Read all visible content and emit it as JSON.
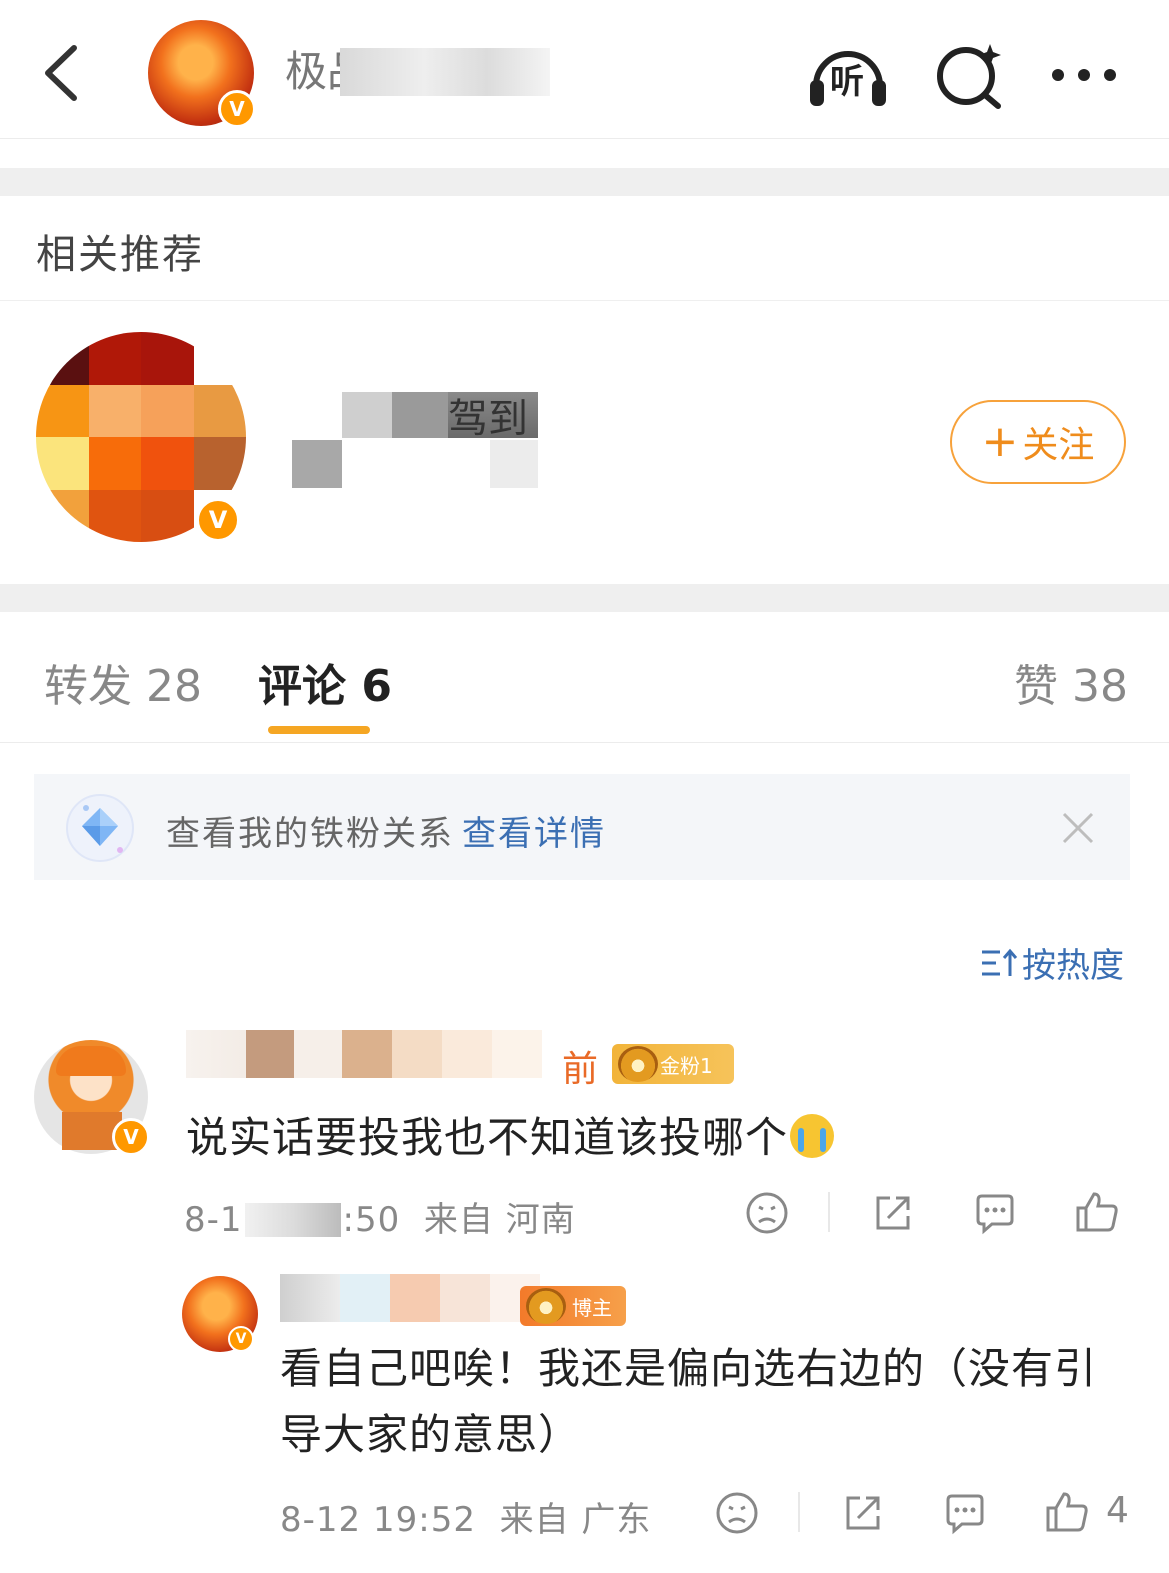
{
  "header": {
    "title": "极品",
    "back_icon": "back-chevron-icon",
    "listen_label": "听",
    "icons": [
      "headphones-listen-icon",
      "search-sparkle-icon",
      "more-dots-icon"
    ]
  },
  "related": {
    "section_title": "相关推荐",
    "account_name_visible": "驾到",
    "follow_label": "关注"
  },
  "tabs": [
    {
      "label": "转发 28",
      "active": false
    },
    {
      "label": "评论 6",
      "active": true
    },
    {
      "label": "赞 38",
      "active": false
    }
  ],
  "fan_banner": {
    "text": "查看我的铁粉关系",
    "link": "查看详情"
  },
  "sort": {
    "label": "按热度"
  },
  "comments": [
    {
      "name_visible": "前",
      "medal": "金粉1",
      "text": "说实话要投我也不知道该投哪个",
      "emoji": "crying-emoji",
      "time_prefix": "8-1",
      "time_suffix": ":50",
      "location": "来自 河南",
      "reply": {
        "medal": "博主",
        "text_line1": "看自己吧唉！我还是偏向选右边的（没有引",
        "text_line2": "导大家的意思）",
        "time": "8-12 19:52",
        "location": "来自 广东",
        "likes": "4"
      }
    }
  ],
  "colors": {
    "accent_orange": "#f5a623",
    "link_blue": "#3b6fb3",
    "badge_orange": "#ff9800"
  }
}
